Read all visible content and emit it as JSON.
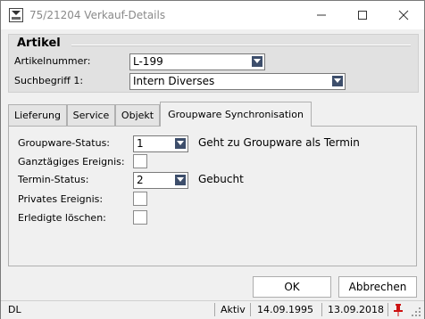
{
  "window": {
    "title": "75/21204 Verkauf-Details"
  },
  "artikel": {
    "group_title": "Artikel",
    "artikelnummer_label": "Artikelnummer:",
    "artikelnummer_value": "L-199",
    "suchbegriff_label": "Suchbegriff 1:",
    "suchbegriff_value": "Intern Diverses"
  },
  "tabs": [
    {
      "label": "Lieferung"
    },
    {
      "label": "Service"
    },
    {
      "label": "Objekt"
    },
    {
      "label": "Groupware Synchronisation"
    }
  ],
  "groupware": {
    "status_label": "Groupware-Status:",
    "status_value": "1",
    "status_desc": "Geht zu Groupware als Termin",
    "ganztaegig_label": "Ganztägiges Ereignis:",
    "termin_status_label": "Termin-Status:",
    "termin_status_value": "2",
    "termin_status_desc": "Gebucht",
    "privat_label": "Privates Ereignis:",
    "erledigte_label": "Erledigte löschen:"
  },
  "buttons": {
    "ok": "OK",
    "abbrechen": "Abbrechen"
  },
  "statusbar": {
    "left": "DL",
    "status": "Aktiv",
    "date1": "14.09.1995",
    "date2": "13.09.2018"
  },
  "colors": {
    "combo_arrow": "#3d4e6b",
    "pin_icon": "#cc1111"
  }
}
